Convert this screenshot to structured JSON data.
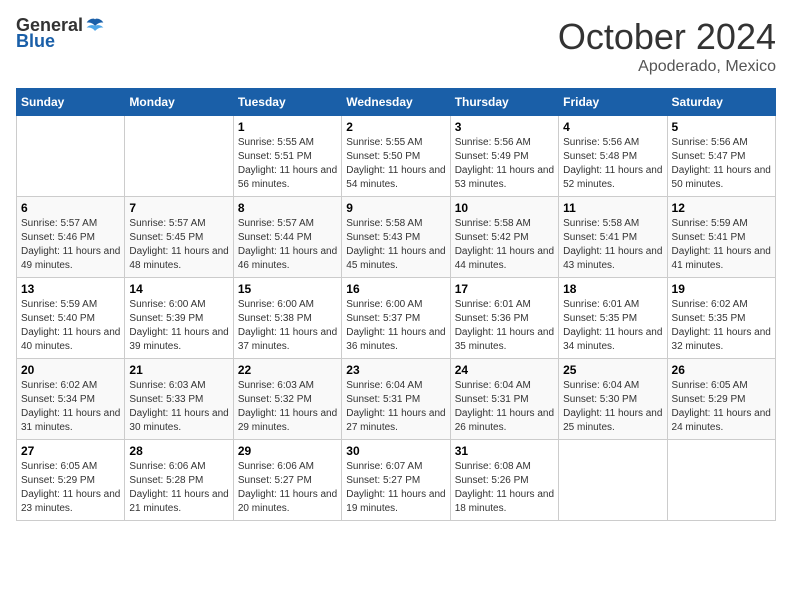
{
  "header": {
    "logo_general": "General",
    "logo_blue": "Blue",
    "month_title": "October 2024",
    "subtitle": "Apoderado, Mexico"
  },
  "days_of_week": [
    "Sunday",
    "Monday",
    "Tuesday",
    "Wednesday",
    "Thursday",
    "Friday",
    "Saturday"
  ],
  "weeks": [
    [
      {
        "day": "",
        "info": ""
      },
      {
        "day": "",
        "info": ""
      },
      {
        "day": "1",
        "info": "Sunrise: 5:55 AM\nSunset: 5:51 PM\nDaylight: 11 hours and 56 minutes."
      },
      {
        "day": "2",
        "info": "Sunrise: 5:55 AM\nSunset: 5:50 PM\nDaylight: 11 hours and 54 minutes."
      },
      {
        "day": "3",
        "info": "Sunrise: 5:56 AM\nSunset: 5:49 PM\nDaylight: 11 hours and 53 minutes."
      },
      {
        "day": "4",
        "info": "Sunrise: 5:56 AM\nSunset: 5:48 PM\nDaylight: 11 hours and 52 minutes."
      },
      {
        "day": "5",
        "info": "Sunrise: 5:56 AM\nSunset: 5:47 PM\nDaylight: 11 hours and 50 minutes."
      }
    ],
    [
      {
        "day": "6",
        "info": "Sunrise: 5:57 AM\nSunset: 5:46 PM\nDaylight: 11 hours and 49 minutes."
      },
      {
        "day": "7",
        "info": "Sunrise: 5:57 AM\nSunset: 5:45 PM\nDaylight: 11 hours and 48 minutes."
      },
      {
        "day": "8",
        "info": "Sunrise: 5:57 AM\nSunset: 5:44 PM\nDaylight: 11 hours and 46 minutes."
      },
      {
        "day": "9",
        "info": "Sunrise: 5:58 AM\nSunset: 5:43 PM\nDaylight: 11 hours and 45 minutes."
      },
      {
        "day": "10",
        "info": "Sunrise: 5:58 AM\nSunset: 5:42 PM\nDaylight: 11 hours and 44 minutes."
      },
      {
        "day": "11",
        "info": "Sunrise: 5:58 AM\nSunset: 5:41 PM\nDaylight: 11 hours and 43 minutes."
      },
      {
        "day": "12",
        "info": "Sunrise: 5:59 AM\nSunset: 5:41 PM\nDaylight: 11 hours and 41 minutes."
      }
    ],
    [
      {
        "day": "13",
        "info": "Sunrise: 5:59 AM\nSunset: 5:40 PM\nDaylight: 11 hours and 40 minutes."
      },
      {
        "day": "14",
        "info": "Sunrise: 6:00 AM\nSunset: 5:39 PM\nDaylight: 11 hours and 39 minutes."
      },
      {
        "day": "15",
        "info": "Sunrise: 6:00 AM\nSunset: 5:38 PM\nDaylight: 11 hours and 37 minutes."
      },
      {
        "day": "16",
        "info": "Sunrise: 6:00 AM\nSunset: 5:37 PM\nDaylight: 11 hours and 36 minutes."
      },
      {
        "day": "17",
        "info": "Sunrise: 6:01 AM\nSunset: 5:36 PM\nDaylight: 11 hours and 35 minutes."
      },
      {
        "day": "18",
        "info": "Sunrise: 6:01 AM\nSunset: 5:35 PM\nDaylight: 11 hours and 34 minutes."
      },
      {
        "day": "19",
        "info": "Sunrise: 6:02 AM\nSunset: 5:35 PM\nDaylight: 11 hours and 32 minutes."
      }
    ],
    [
      {
        "day": "20",
        "info": "Sunrise: 6:02 AM\nSunset: 5:34 PM\nDaylight: 11 hours and 31 minutes."
      },
      {
        "day": "21",
        "info": "Sunrise: 6:03 AM\nSunset: 5:33 PM\nDaylight: 11 hours and 30 minutes."
      },
      {
        "day": "22",
        "info": "Sunrise: 6:03 AM\nSunset: 5:32 PM\nDaylight: 11 hours and 29 minutes."
      },
      {
        "day": "23",
        "info": "Sunrise: 6:04 AM\nSunset: 5:31 PM\nDaylight: 11 hours and 27 minutes."
      },
      {
        "day": "24",
        "info": "Sunrise: 6:04 AM\nSunset: 5:31 PM\nDaylight: 11 hours and 26 minutes."
      },
      {
        "day": "25",
        "info": "Sunrise: 6:04 AM\nSunset: 5:30 PM\nDaylight: 11 hours and 25 minutes."
      },
      {
        "day": "26",
        "info": "Sunrise: 6:05 AM\nSunset: 5:29 PM\nDaylight: 11 hours and 24 minutes."
      }
    ],
    [
      {
        "day": "27",
        "info": "Sunrise: 6:05 AM\nSunset: 5:29 PM\nDaylight: 11 hours and 23 minutes."
      },
      {
        "day": "28",
        "info": "Sunrise: 6:06 AM\nSunset: 5:28 PM\nDaylight: 11 hours and 21 minutes."
      },
      {
        "day": "29",
        "info": "Sunrise: 6:06 AM\nSunset: 5:27 PM\nDaylight: 11 hours and 20 minutes."
      },
      {
        "day": "30",
        "info": "Sunrise: 6:07 AM\nSunset: 5:27 PM\nDaylight: 11 hours and 19 minutes."
      },
      {
        "day": "31",
        "info": "Sunrise: 6:08 AM\nSunset: 5:26 PM\nDaylight: 11 hours and 18 minutes."
      },
      {
        "day": "",
        "info": ""
      },
      {
        "day": "",
        "info": ""
      }
    ]
  ]
}
